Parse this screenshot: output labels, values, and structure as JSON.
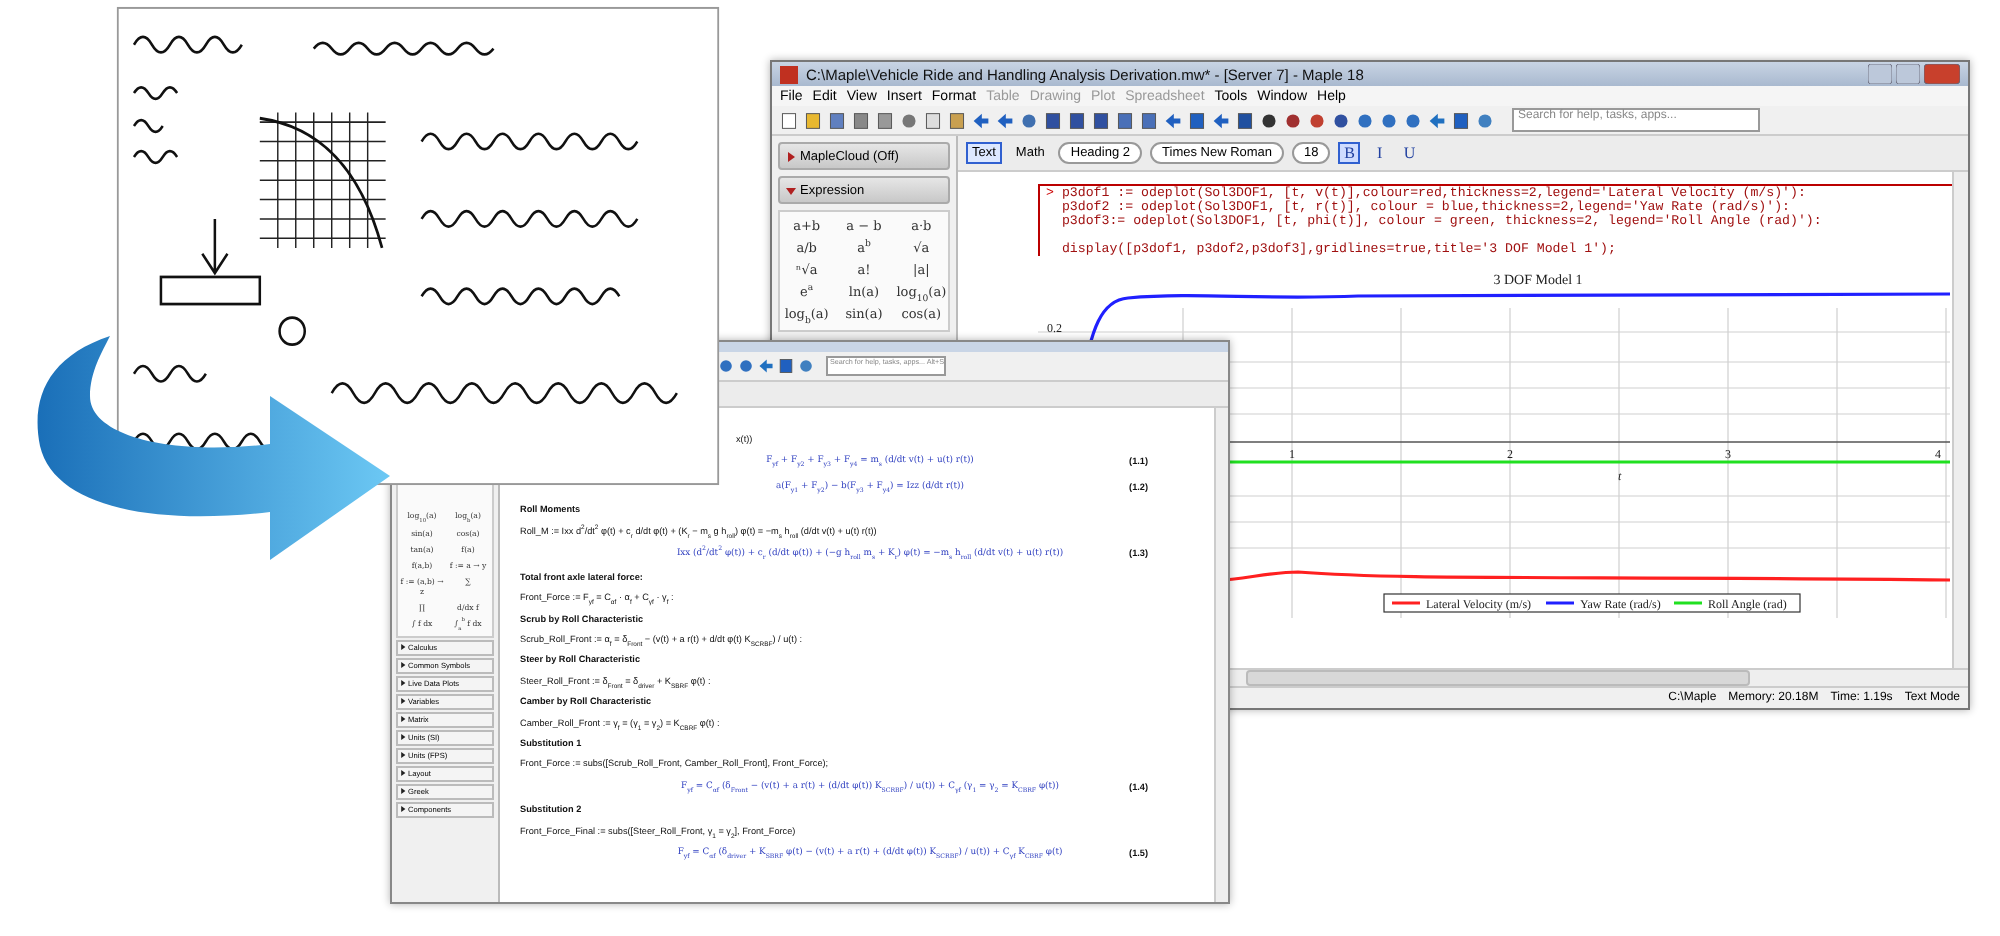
{
  "back_window": {
    "title": "C:\\Maple\\Vehicle Ride and Handling Analysis Derivation.mw* - [Server 7] - Maple 18",
    "menu": [
      {
        "label": "File",
        "disabled": false
      },
      {
        "label": "Edit",
        "disabled": false
      },
      {
        "label": "View",
        "disabled": false
      },
      {
        "label": "Insert",
        "disabled": false
      },
      {
        "label": "Format",
        "disabled": false
      },
      {
        "label": "Table",
        "disabled": true
      },
      {
        "label": "Drawing",
        "disabled": true
      },
      {
        "label": "Plot",
        "disabled": true
      },
      {
        "label": "Spreadsheet",
        "disabled": true
      },
      {
        "label": "Tools",
        "disabled": false
      },
      {
        "label": "Window",
        "disabled": false
      },
      {
        "label": "Help",
        "disabled": false
      }
    ],
    "search": {
      "placeholder": "Search for help, tasks, apps..."
    },
    "palettes": [
      {
        "label": "MapleCloud (Off)",
        "expanded": false
      },
      {
        "label": "Expression",
        "expanded": true
      }
    ],
    "expression_items": [
      "a+b",
      "a − b",
      "a·b",
      "a/b",
      "a$^{b}$",
      "√a",
      "ⁿ√a",
      "a!",
      "|a|",
      "e$^{a}$",
      "ln(a)",
      "log$_{10}$(a)",
      "log$_{b}$(a)",
      "sin(a)",
      "cos(a)"
    ],
    "mode_tabs": [
      {
        "label": "Text",
        "selected": true
      },
      {
        "label": "Math",
        "selected": false
      }
    ],
    "style_box": "Heading 2",
    "font_box": "Times New Roman",
    "size_box": "18",
    "format_buttons": [
      {
        "label": "B",
        "on": true
      },
      {
        "label": "I",
        "on": false
      },
      {
        "label": "U",
        "on": false
      }
    ],
    "prompt": ">",
    "code": [
      "p3dof1 := odeplot(Sol3DOF1, [t, v(t)],colour=red,thickness=2,legend='Lateral Velocity (m/s)'):",
      "p3dof2 := odeplot(Sol3DOF1, [t, r(t)], colour = blue,thickness=2,legend='Yaw Rate (rad/s)'):",
      "p3dof3:= odeplot(Sol3DOF1, [t, phi(t)], colour = green, thickness=2, legend='Roll Angle (rad)'):",
      "display([p3dof1, p3dof2,p3dof3],gridlines=true,title='3 DOF Model 1');"
    ],
    "plot": {
      "title": "3 DOF Model 1",
      "y_tick": "0.2",
      "x_ticks": [
        "1",
        "2",
        "3",
        "4"
      ],
      "xlabel": "t",
      "series": [
        {
          "label": "Lateral Velocity (m/s)",
          "color": "#ff2020"
        },
        {
          "label": "Yaw Rate (rad/s)",
          "color": "#2020ff"
        },
        {
          "label": "Roll Angle (rad)",
          "color": "#20e020"
        }
      ]
    },
    "status": [
      "C:\\Maple",
      "Memory: 20.18M",
      "Time: 1.19s",
      "Text Mode"
    ]
  },
  "front_window": {
    "search": {
      "placeholder": "Search for help, tasks, apps... Alt+S"
    },
    "palette_items": [
      "log$_{10}$(a)",
      "log$_{b}$(a)",
      "sin(a)",
      "cos(a)",
      "tan(a)",
      "f(a)",
      "f(a,b)",
      "f := a → y",
      "f := (a,b) → z",
      "∑",
      "∏",
      "d/dx f",
      "∫ f dx",
      "∫$_{a}$$^{b}$ f dx"
    ],
    "sections": [
      "Calculus",
      "Common Symbols",
      "Live Data Plots",
      "Variables",
      "Matrix",
      "Units (SI)",
      "Units (FPS)",
      "Layout",
      "Greek",
      "Components"
    ],
    "document": [
      {
        "kind": "input",
        "text": "x(t))"
      },
      {
        "kind": "equation",
        "text": "F$_{yf}$ + F$_{y2}$ + F$_{y3}$ + F$_{y4}$ = m$_{s}$ (d/dt v(t) + u(t) r(t))",
        "number": "(1.1)"
      },
      {
        "kind": "equation",
        "text": "a(F$_{y1}$ + F$_{y2}$) − b(F$_{y3}$ + F$_{y4}$) = Izz (d/dt r(t))",
        "number": "(1.2)"
      },
      {
        "kind": "heading",
        "text": "Roll Moments"
      },
      {
        "kind": "input",
        "text": "Roll_M := Ixx d$^{2}$/dt$^{2}$ φ(t) + c$_{r}$ d/dt φ(t) + (K$_{r}$ − m$_{s}$ g h$_{roll}$) φ(t) = −m$_{s}$ h$_{roll}$ (d/dt v(t) + u(t) r(t))"
      },
      {
        "kind": "equation",
        "text": "Ixx (d$^{2}$/dt$^{2}$ φ(t)) + c$_{r}$ (d/dt φ(t)) + (−g h$_{roll}$ m$_{s}$ + K$_{r}$) φ(t) = −m$_{s}$ h$_{roll}$ (d/dt v(t) + u(t) r(t))",
        "number": "(1.3)"
      },
      {
        "kind": "heading",
        "text": "Total front axle lateral force:"
      },
      {
        "kind": "input",
        "text": "Front_Force := F$_{yf}$ = C$_{αf}$ · α$_{f}$ + C$_{γf}$ · γ$_{f}$ :"
      },
      {
        "kind": "heading",
        "text": "Scrub by Roll Characteristic"
      },
      {
        "kind": "input",
        "text": "Scrub_Roll_Front := α$_{f}$ = δ$_{Front}$ − (v(t) + a r(t) + d/dt φ(t) K$_{SCRBF}$) / u(t) :"
      },
      {
        "kind": "heading",
        "text": "Steer by Roll Characteristic"
      },
      {
        "kind": "input",
        "text": "Steer_Roll_Front := δ$_{Front}$ = δ$_{driver}$ + K$_{SBRF}$ φ(t) :"
      },
      {
        "kind": "heading",
        "text": "Camber by Roll Characteristic"
      },
      {
        "kind": "input",
        "text": "Camber_Roll_Front := γ$_{f}$ = (γ$_{1}$ = γ$_{2}$) = K$_{CBRF}$ φ(t) :"
      },
      {
        "kind": "heading",
        "text": "Substitution 1"
      },
      {
        "kind": "input",
        "text": "Front_Force := subs([Scrub_Roll_Front, Camber_Roll_Front], Front_Force);"
      },
      {
        "kind": "equation",
        "text": "F$_{yf}$ = C$_{αf}$ (δ$_{Front}$ − (v(t) + a r(t) + (d/dt φ(t)) K$_{SCRBF}$) / u(t)) + C$_{γf}$ (γ$_{1}$ = γ$_{2}$ = K$_{CBRF}$ φ(t))",
        "number": "(1.4)"
      },
      {
        "kind": "heading",
        "text": "Substitution 2"
      },
      {
        "kind": "input",
        "text": "Front_Force_Final := subs([Steer_Roll_Front, γ$_{1}$ = γ$_{2}$], Front_Force)"
      },
      {
        "kind": "equation",
        "text": "F$_{yf}$ = C$_{αf}$ (δ$_{driver}$ + K$_{SBRF}$ φ(t) − (v(t) + a r(t) + (d/dt φ(t)) K$_{SCRBF}$) / u(t)) + C$_{γf}$ K$_{CBRF}$ φ(t)",
        "number": "(1.5)"
      }
    ]
  }
}
